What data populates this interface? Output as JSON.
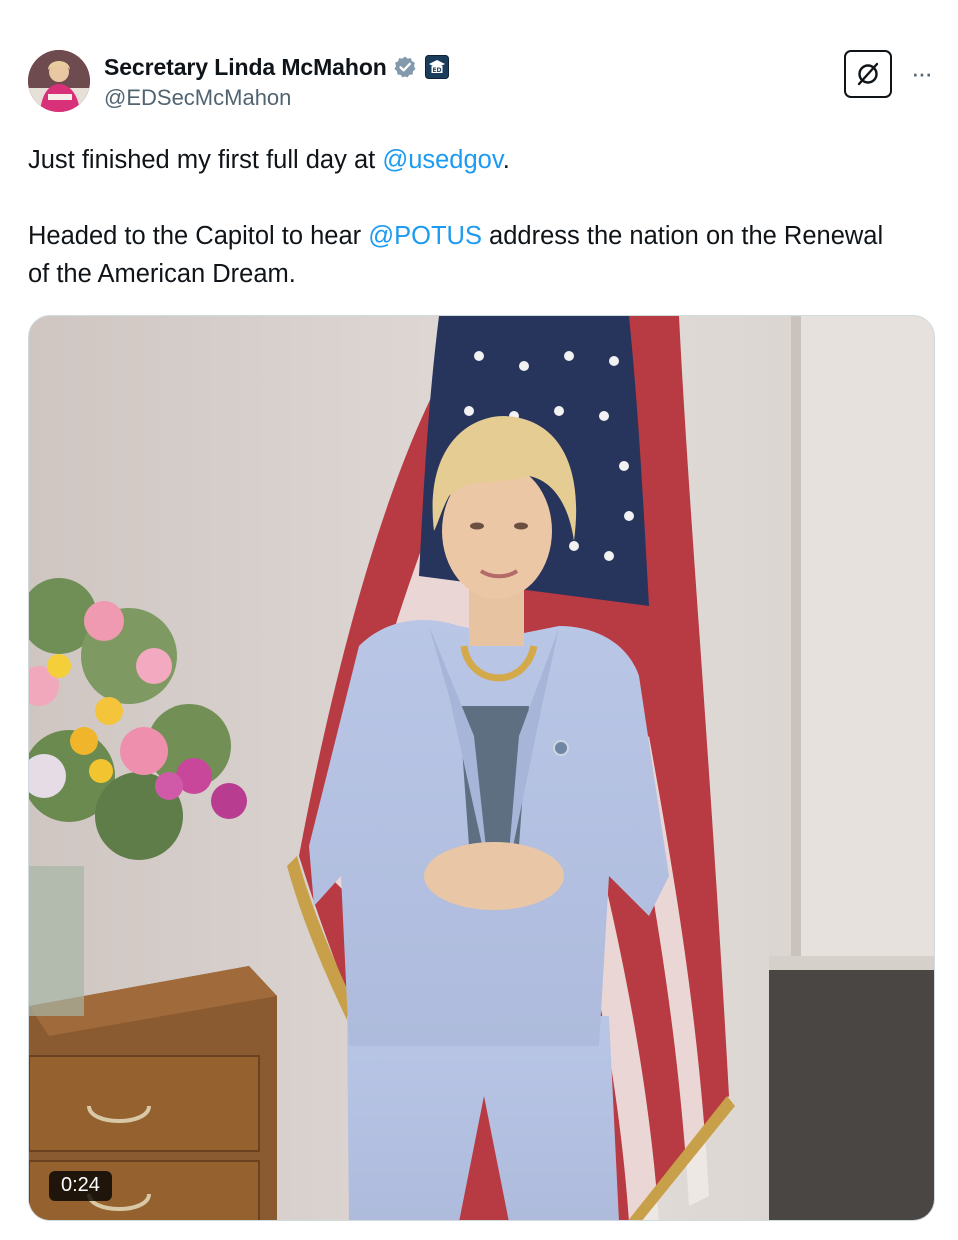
{
  "author": {
    "display_name": "Secretary Linda McMahon",
    "handle": "@EDSecMcMahon",
    "verified_icon": "verified-badge-icon",
    "affiliation_icon": "education-department-icon"
  },
  "actions": {
    "grok_icon": "grok-icon",
    "more_label": "···"
  },
  "post": {
    "line1_prefix": "Just finished my first full day at ",
    "line1_mention": "@usedgov",
    "line1_suffix": ".",
    "line2_prefix": "Headed to the Capitol to hear ",
    "line2_mention": "@POTUS",
    "line2_suffix": " address the nation on the Renewal of the American Dream."
  },
  "media": {
    "type": "video",
    "duration": "0:24"
  },
  "colors": {
    "mention": "#1d9bf0",
    "verified": "#829aab",
    "text": "#0f1419",
    "secondary": "#536471"
  }
}
